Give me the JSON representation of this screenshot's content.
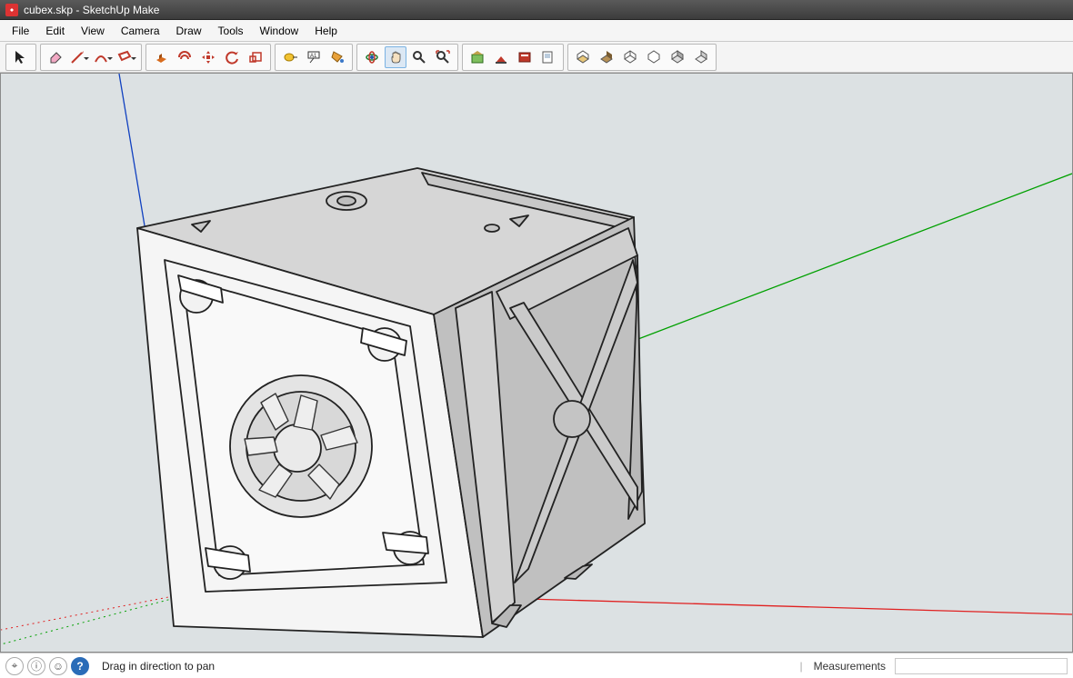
{
  "app": {
    "title": "cubex.skp - SketchUp Make"
  },
  "menu": [
    {
      "key": "file",
      "label": "File"
    },
    {
      "key": "edit",
      "label": "Edit"
    },
    {
      "key": "view",
      "label": "View"
    },
    {
      "key": "camera",
      "label": "Camera"
    },
    {
      "key": "draw",
      "label": "Draw"
    },
    {
      "key": "tools",
      "label": "Tools"
    },
    {
      "key": "window",
      "label": "Window"
    },
    {
      "key": "help",
      "label": "Help"
    }
  ],
  "toolbar": {
    "groups": [
      {
        "id": "select",
        "items": [
          {
            "id": "select",
            "icon": "cursor"
          }
        ]
      },
      {
        "id": "edit",
        "items": [
          {
            "id": "eraser",
            "icon": "eraser"
          },
          {
            "id": "line",
            "icon": "pencil",
            "dropdown": true
          },
          {
            "id": "arc",
            "icon": "arc",
            "dropdown": true
          },
          {
            "id": "rect",
            "icon": "rect",
            "dropdown": true
          }
        ]
      },
      {
        "id": "mods",
        "items": [
          {
            "id": "pushpull",
            "icon": "pushpull"
          },
          {
            "id": "offset",
            "icon": "offset"
          },
          {
            "id": "move",
            "icon": "move"
          },
          {
            "id": "rotate",
            "icon": "rotate"
          },
          {
            "id": "scale",
            "icon": "scale"
          }
        ]
      },
      {
        "id": "measure",
        "items": [
          {
            "id": "tape",
            "icon": "tape"
          },
          {
            "id": "text",
            "icon": "text"
          },
          {
            "id": "paint",
            "icon": "bucket"
          }
        ]
      },
      {
        "id": "camera",
        "items": [
          {
            "id": "orbit",
            "icon": "orbit"
          },
          {
            "id": "pan",
            "icon": "hand",
            "active": true
          },
          {
            "id": "zoom",
            "icon": "zoom"
          },
          {
            "id": "zoomext",
            "icon": "zoomext"
          }
        ]
      },
      {
        "id": "warehouse",
        "items": [
          {
            "id": "3dwh",
            "icon": "wh"
          },
          {
            "id": "3dwh2",
            "icon": "wh2"
          },
          {
            "id": "ext",
            "icon": "stack"
          },
          {
            "id": "layout",
            "icon": "layout"
          }
        ]
      },
      {
        "id": "styles",
        "items": [
          {
            "id": "xray",
            "icon": "s1"
          },
          {
            "id": "back",
            "icon": "s2"
          },
          {
            "id": "wire",
            "icon": "s3"
          },
          {
            "id": "hidden",
            "icon": "s4"
          },
          {
            "id": "shaded",
            "icon": "s5"
          },
          {
            "id": "mono",
            "icon": "s6"
          }
        ]
      }
    ]
  },
  "status": {
    "hint": "Drag in direction to pan",
    "measurements_label": "Measurements",
    "measurements_value": ""
  },
  "colors": {
    "axis_x": "#e02020",
    "axis_y": "#00a000",
    "axis_z": "#1040c0",
    "bg": "#dce1e3"
  }
}
